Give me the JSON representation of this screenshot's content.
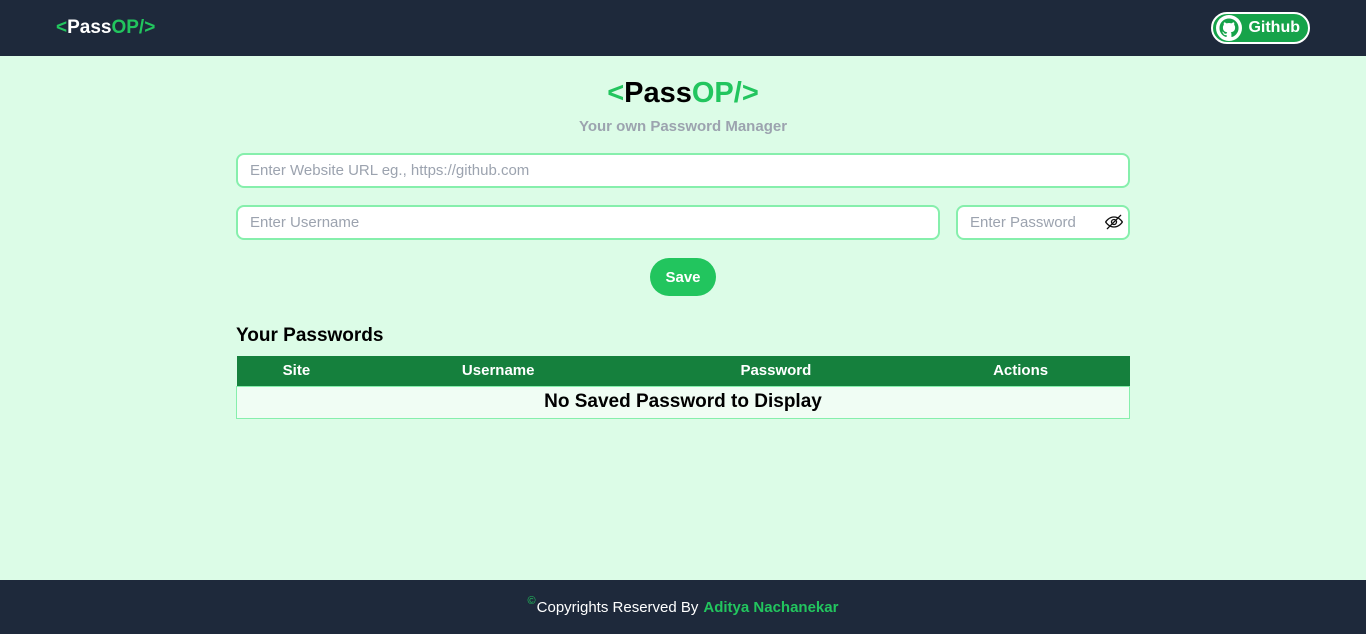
{
  "nav": {
    "logo_open": "<",
    "logo_pass": "Pass",
    "logo_op": "OP/>",
    "github_label": "Github"
  },
  "hero": {
    "title_open": "<",
    "title_pass": "Pass",
    "title_op": "OP/>",
    "subtitle": "Your own Password Manager"
  },
  "form": {
    "url_placeholder": "Enter Website URL eg., https://github.com",
    "username_placeholder": "Enter Username",
    "password_placeholder": "Enter Password",
    "save_label": "Save"
  },
  "passwords": {
    "heading": "Your Passwords",
    "columns": [
      "Site",
      "Username",
      "Password",
      "Actions"
    ],
    "empty_message": "No Saved Password to Display"
  },
  "footer": {
    "copyright_symbol": "©",
    "text": "Copyrights Reserved By",
    "author": "Aditya Nachanekar"
  },
  "colors": {
    "accent": "#22c55e",
    "nav_bg": "#1e293b",
    "page_bg": "#dcfce7",
    "table_header": "#15803d"
  }
}
